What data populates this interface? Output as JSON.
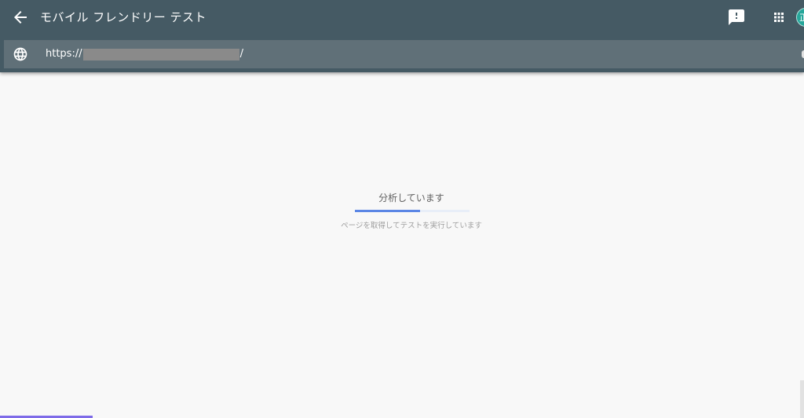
{
  "header": {
    "title": "モバイル フレンドリー テスト",
    "avatar_initial": "正",
    "icons": {
      "back": "arrow-back-icon",
      "feedback": "feedback-icon",
      "apps": "apps-grid-icon"
    }
  },
  "urlbar": {
    "icon": "globe-icon",
    "prefix": "https://",
    "suffix": "/"
  },
  "status": {
    "title": "分析しています",
    "subtitle": "ページを取得してテストを実行しています",
    "progress_percent": 57
  },
  "colors": {
    "header_bg": "#455a64",
    "urlbar_bg": "#607078",
    "progress_fill": "#5b86e5",
    "progress_track": "#e8eef8",
    "avatar_bg": "#26a69a",
    "bottom_accent": "#7e6be8"
  }
}
